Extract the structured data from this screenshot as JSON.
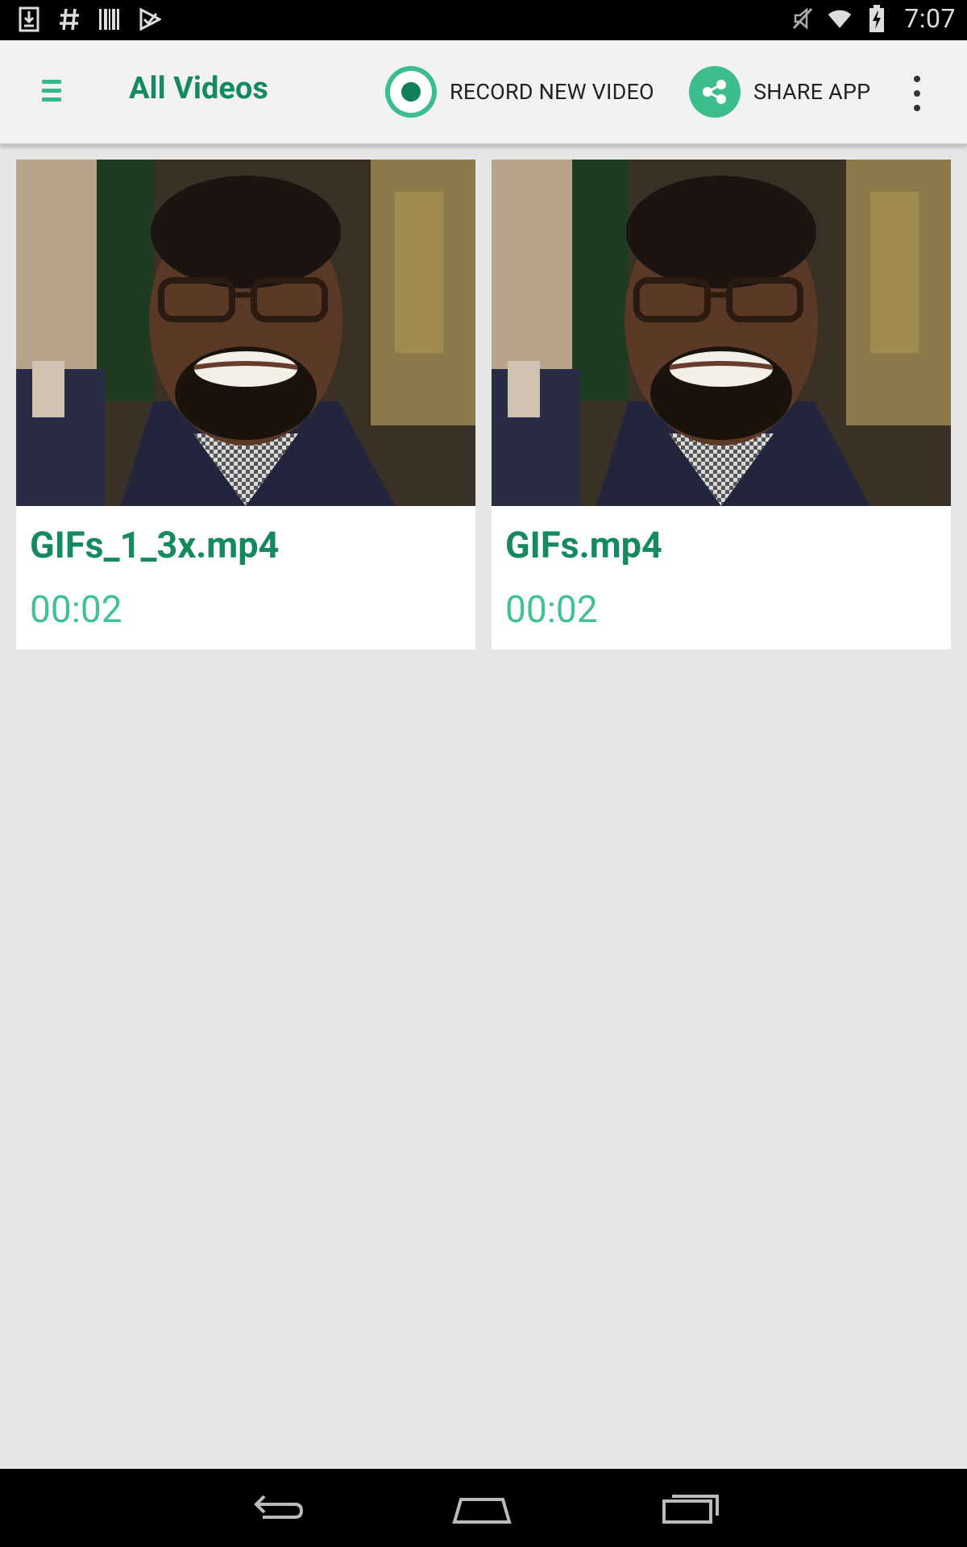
{
  "status_bar": {
    "time": "7:07",
    "icons": [
      "download-icon",
      "hashtag-icon",
      "barcode-icon",
      "checkmark-icon",
      "mute-icon",
      "wifi-icon",
      "battery-charging-icon"
    ]
  },
  "action_bar": {
    "title": "All Videos",
    "record_label": "RECORD NEW VIDEO",
    "share_label": "SHARE APP",
    "accent_color": "#158a5f",
    "icon_color": "#3cbd8e"
  },
  "videos": [
    {
      "name": "GIFs_1_3x.mp4",
      "duration": "00:02"
    },
    {
      "name": "GIFs.mp4",
      "duration": "00:02"
    }
  ],
  "nav_bar": {
    "icons": [
      "back-icon",
      "home-icon",
      "recent-apps-icon"
    ]
  }
}
